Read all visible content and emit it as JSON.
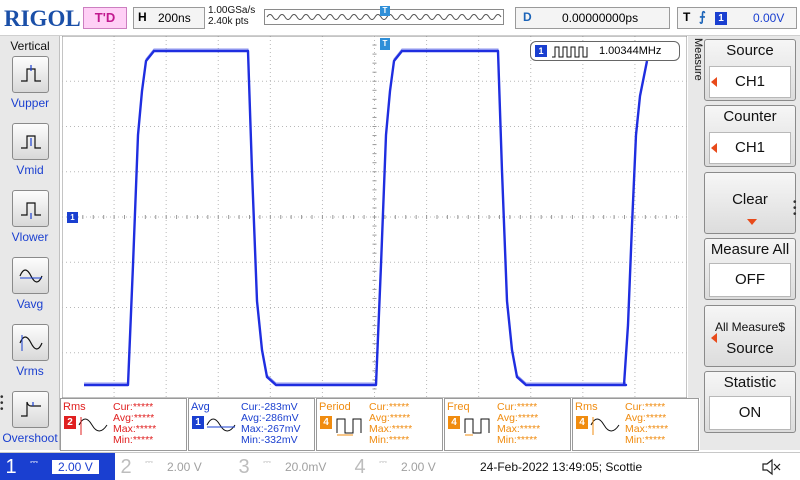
{
  "header": {
    "logo": "RIGOL",
    "run_state": "T'D",
    "horizontal": {
      "key": "H",
      "value": "200ns"
    },
    "sample_rate": "1.00GSa/s",
    "memory_points": "2.40k pts",
    "delay": {
      "key": "D",
      "value": "0.00000000ps"
    },
    "trigger": {
      "key": "T",
      "edge": "rising-edge-icon",
      "channel": "1",
      "level": "0.00V"
    }
  },
  "left_panel": {
    "title": "Vertical",
    "items": [
      {
        "label": "Vupper",
        "icon": "vupper-icon"
      },
      {
        "label": "Vmid",
        "icon": "vmid-icon"
      },
      {
        "label": "Vlower",
        "icon": "vlower-icon"
      },
      {
        "label": "Vavg",
        "icon": "vavg-icon"
      },
      {
        "label": "Vrms",
        "icon": "vrms-icon"
      },
      {
        "label": "Overshoot",
        "icon": "overshoot-icon"
      }
    ]
  },
  "waveform": {
    "channel": "1",
    "color": "#1f2ee0",
    "freq_counter_label": "1.00344MHz",
    "ch1_marker": "1",
    "trigger_marker": "T"
  },
  "right_panel": {
    "side_label": "Measure",
    "buttons": [
      {
        "title": "Source",
        "value": "CH1"
      },
      {
        "title": "Counter",
        "value": "CH1"
      },
      {
        "title": "Clear",
        "value": ""
      },
      {
        "title": "Measure All",
        "value": "OFF"
      },
      {
        "title": "All Measure$",
        "value": "Source"
      },
      {
        "title": "Statistic",
        "value": "ON"
      }
    ]
  },
  "measurements": [
    {
      "title": "Rms",
      "channel": "2",
      "color": "#e02020",
      "icon": "sine-icon",
      "cur": "Cur:*****",
      "avg": "Avg:*****",
      "max": "Max:*****",
      "min": "Min:*****"
    },
    {
      "title": "Avg",
      "channel": "1",
      "color": "#1a3fd0",
      "icon": "sine-icon",
      "cur": "Cur:-283mV",
      "avg": "Avg:-286mV",
      "max": "Max:-267mV",
      "min": "Min:-332mV"
    },
    {
      "title": "Period",
      "channel": "4",
      "color": "#f08c10",
      "icon": "period-icon",
      "cur": "Cur:*****",
      "avg": "Avg:*****",
      "max": "Max:*****",
      "min": "Min:*****"
    },
    {
      "title": "Freq",
      "channel": "4",
      "color": "#f08c10",
      "icon": "freq-icon",
      "cur": "Cur:*****",
      "avg": "Avg:*****",
      "max": "Max:*****",
      "min": "Min:*****"
    },
    {
      "title": "Rms",
      "channel": "4",
      "color": "#f08c10",
      "icon": "sine-icon",
      "cur": "Cur:*****",
      "avg": "Avg:*****",
      "max": "Max:*****",
      "min": "Min:*****"
    }
  ],
  "channels": [
    {
      "num": "1",
      "scale": "2.00 V",
      "active": true,
      "color": "#1a3fd0"
    },
    {
      "num": "2",
      "scale": "2.00 V",
      "active": false,
      "color": "#c8c8c8"
    },
    {
      "num": "3",
      "scale": "20.0mV",
      "active": false,
      "color": "#c8c8c8"
    },
    {
      "num": "4",
      "scale": "2.00 V",
      "active": false,
      "color": "#c8c8c8"
    }
  ],
  "status": {
    "datetime": "24-Feb-2022 13:49:05; Scottie",
    "speaker_icon": "speaker-muted-icon"
  }
}
